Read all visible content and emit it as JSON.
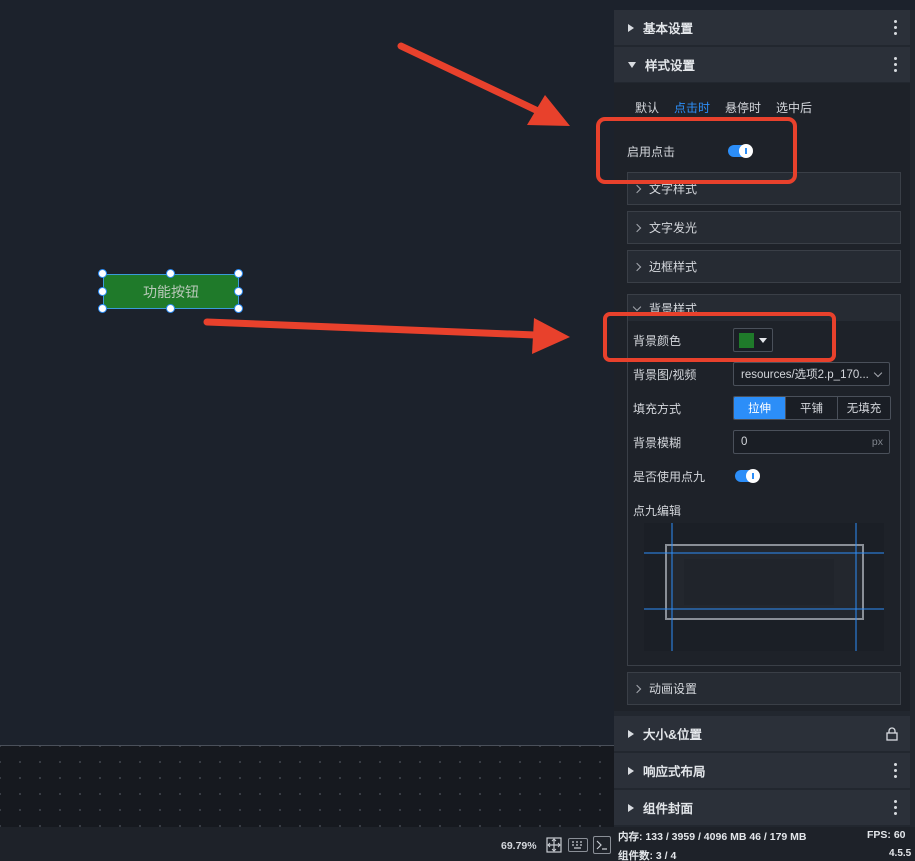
{
  "canvas": {
    "widget_label": "功能按钮"
  },
  "panel": {
    "sections_top": [
      {
        "label": "基本设置",
        "expanded": false,
        "action_icon": "kebab-icon"
      },
      {
        "label": "样式设置",
        "expanded": true,
        "action_icon": "kebab-icon"
      }
    ],
    "state_tabs": [
      {
        "label": "默认",
        "active": false
      },
      {
        "label": "点击时",
        "active": true
      },
      {
        "label": "悬停时",
        "active": false
      },
      {
        "label": "选中后",
        "active": false
      }
    ],
    "enable_click": {
      "label": "启用点击",
      "on": true
    },
    "collapsibles": [
      {
        "label": "文字样式"
      },
      {
        "label": "文字发光"
      },
      {
        "label": "边框样式"
      }
    ],
    "background": {
      "title": "背景样式",
      "color_label": "背景颜色",
      "color_value": "#1f7a2a",
      "image_label": "背景图/视频",
      "image_value": "resources/选项2.p_170...",
      "fill_label": "填充方式",
      "fill_options": [
        "拉伸",
        "平铺",
        "无填充"
      ],
      "fill_selected": "拉伸",
      "blur_label": "背景模糊",
      "blur_value": "0",
      "blur_unit": "px",
      "nine_label": "是否使用点九",
      "nine_on": true,
      "nine_edit_label": "点九编辑"
    },
    "animation": {
      "label": "动画设置"
    },
    "sections_bottom": [
      {
        "label": "大小&位置",
        "action_icon": "lock-icon"
      },
      {
        "label": "响应式布局",
        "action_icon": "kebab-icon"
      },
      {
        "label": "组件封面",
        "action_icon": "kebab-icon"
      }
    ]
  },
  "status": {
    "zoom": "69.79%",
    "memory": "内存:  133 / 3959 / 4096 MB  46 / 179 MB",
    "components": "组件数: 3 / 4",
    "fps": "FPS:  60",
    "version": "4.5.5"
  },
  "colors": {
    "accent": "#2c8ef8",
    "annotation": "#e8412c",
    "widget_fill": "#1f7a2a"
  }
}
